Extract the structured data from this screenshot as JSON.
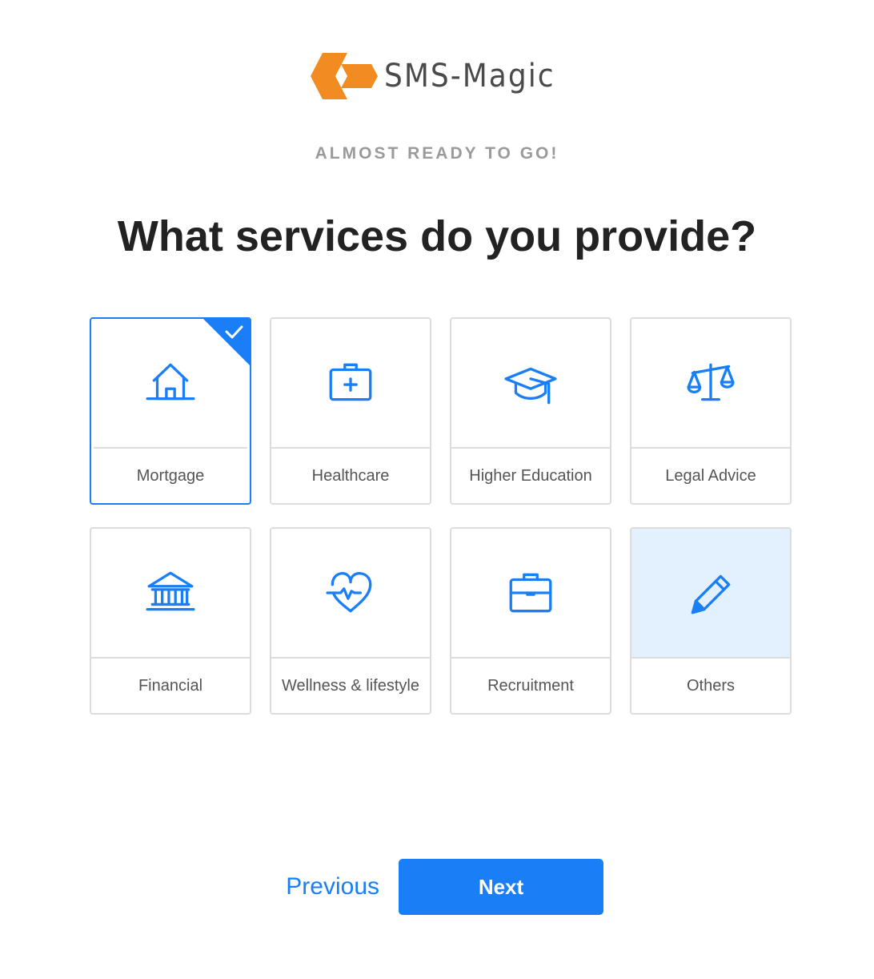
{
  "brand": {
    "name": "SMS-Magic",
    "mark_color": "#f28c22",
    "text_color": "#4a4a4a"
  },
  "kicker": "ALMOST READY TO GO!",
  "title": "What services do you provide?",
  "accent_color": "#1a7ef7",
  "services": [
    {
      "label": "Mortgage",
      "icon": "house-icon",
      "selected": true
    },
    {
      "label": "Healthcare",
      "icon": "medical-kit-icon",
      "selected": false
    },
    {
      "label": "Higher Education",
      "icon": "graduation-cap-icon",
      "selected": false
    },
    {
      "label": "Legal Advice",
      "icon": "scales-icon",
      "selected": false
    },
    {
      "label": "Financial",
      "icon": "bank-icon",
      "selected": false
    },
    {
      "label": "Wellness & lifestyle",
      "icon": "heart-pulse-icon",
      "selected": false
    },
    {
      "label": "Recruitment",
      "icon": "briefcase-icon",
      "selected": false
    },
    {
      "label": "Others",
      "icon": "pencil-icon",
      "selected": false,
      "highlighted": true
    }
  ],
  "nav": {
    "previous_label": "Previous",
    "next_label": "Next"
  }
}
